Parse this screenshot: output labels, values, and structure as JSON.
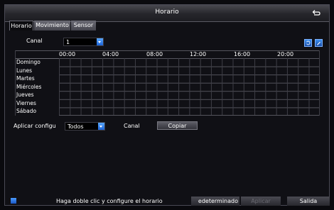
{
  "window": {
    "title": "Horario"
  },
  "tabs": [
    {
      "label": "Horario",
      "active": true
    },
    {
      "label": "Movimiento",
      "active": false
    },
    {
      "label": "Sensor",
      "active": false
    }
  ],
  "channel": {
    "label": "Canal",
    "value": "1"
  },
  "schedule": {
    "hours": [
      "00:00",
      "04:00",
      "08:00",
      "12:00",
      "16:00",
      "20:00"
    ],
    "days": [
      "Domingo",
      "Lunes",
      "Martes",
      "Miércoles",
      "Jueves",
      "Viernes",
      "Sábado"
    ]
  },
  "apply_config": {
    "label": "Aplicar configu",
    "value": "Todos",
    "channel_label": "Canal",
    "copy_label": "Copiar"
  },
  "footer": {
    "hint": "Haga doble clic y configure el horario",
    "default_label": "edeterminado",
    "apply_label": "Aplicar",
    "exit_label": "Salida"
  },
  "colors": {
    "accent": "#2a7ae8",
    "background": "#101015",
    "text": "#ffffff",
    "disabled_text": "#6a6a72"
  }
}
